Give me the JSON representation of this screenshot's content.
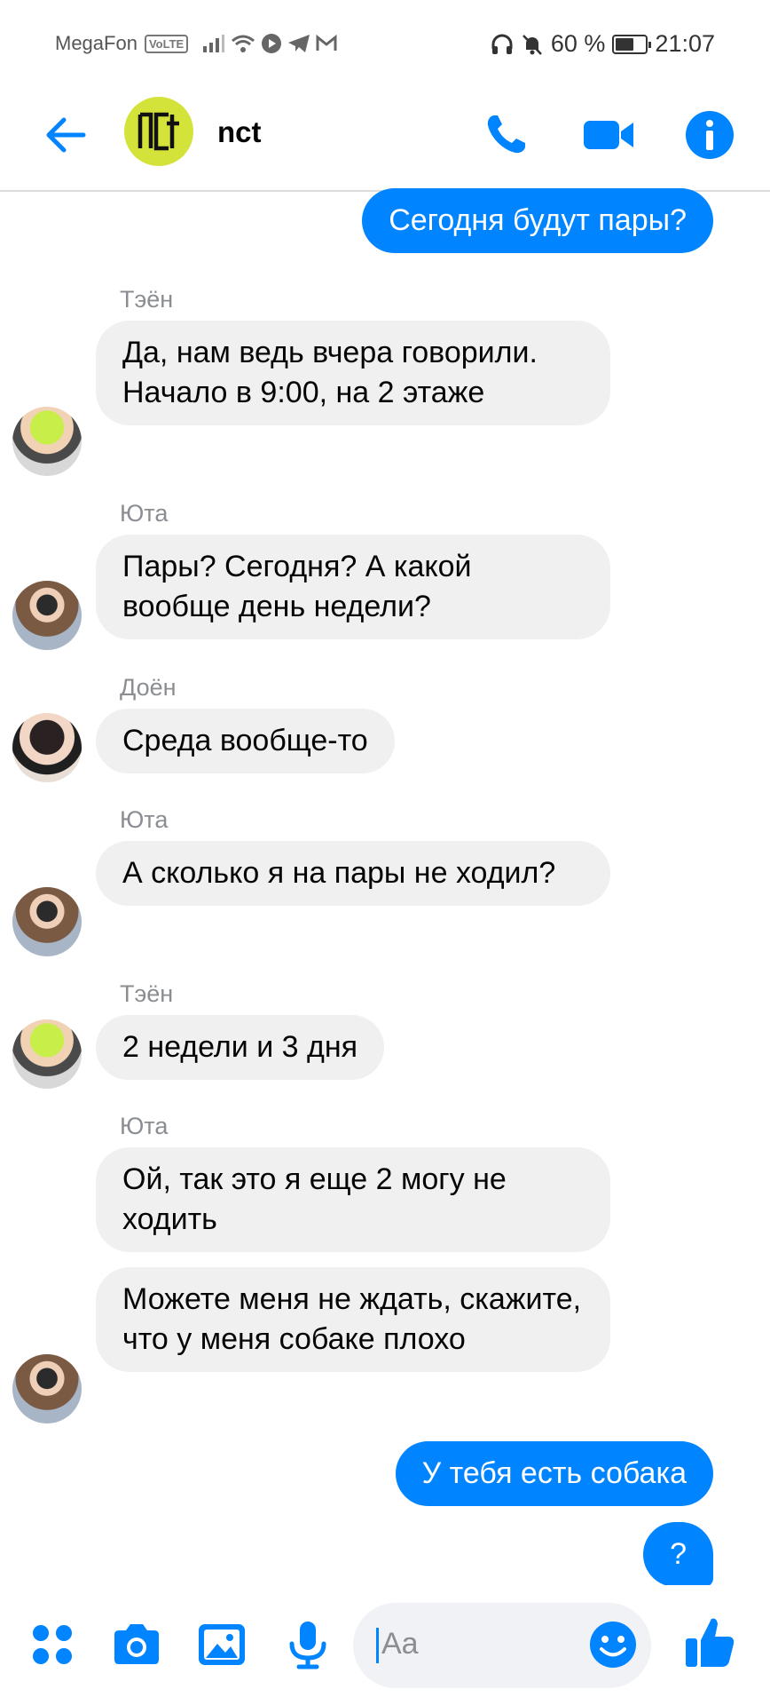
{
  "status_bar": {
    "carrier": "MegaFon",
    "network_badge": "VoLTE",
    "signal_icon": "signal-icon",
    "battery_percent": "60 %",
    "battery_level": 0.6,
    "time": "21:07"
  },
  "header": {
    "group_name": "nct",
    "avatar_text": "nct",
    "icons": [
      "back-arrow-icon",
      "phone-icon",
      "video-camera-icon",
      "info-icon"
    ]
  },
  "messages": [
    {
      "type": "out",
      "text": "Сегодня будут пары?"
    },
    {
      "type": "in",
      "sender": "Тэён",
      "text": "Да, нам ведь вчера говорили. Начало в 9:00, на 2 этаже"
    },
    {
      "type": "in",
      "sender": "Юта",
      "text": "Пары? Сегодня? А какой вообще день недели?"
    },
    {
      "type": "in",
      "sender": "Доён",
      "text": "Среда вообще-то"
    },
    {
      "type": "in",
      "sender": "Юта",
      "text": "А сколько я на пары не ходил?"
    },
    {
      "type": "in",
      "sender": "Тэён",
      "text": "2 недели и 3 дня"
    },
    {
      "type": "in",
      "sender": "Юта",
      "text": "Ой, так это я еще 2 могу не ходить"
    },
    {
      "type": "in",
      "text": "Можете меня не ждать, скажите, что у меня собаке плохо"
    },
    {
      "type": "out",
      "text": "У тебя есть собака"
    },
    {
      "type": "out",
      "text": "?"
    }
  ],
  "composer": {
    "placeholder": "Aa",
    "icons": [
      "apps-grid-icon",
      "camera-icon",
      "gallery-icon",
      "microphone-icon",
      "emoji-icon",
      "thumbs-up-icon"
    ]
  },
  "colors": {
    "accent": "#0084ff",
    "incoming_bubble": "#f0f0f0",
    "sender_label": "#8a8d91",
    "group_avatar": "#d4e33a"
  }
}
